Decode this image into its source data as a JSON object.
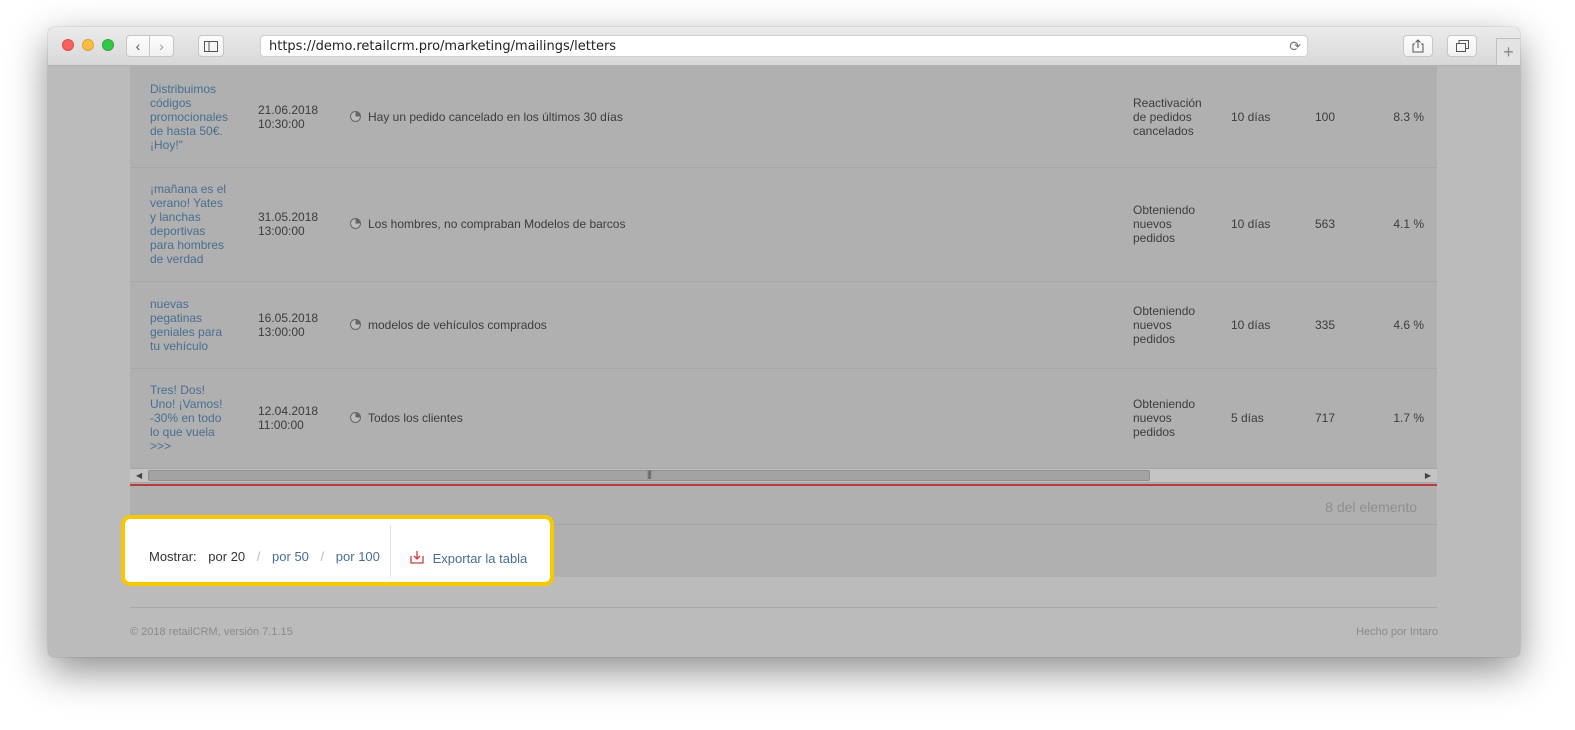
{
  "browser": {
    "url": "https://demo.retailcrm.pro/marketing/mailings/letters",
    "icons": {
      "back": "chevron-left-icon",
      "forward": "chevron-right-icon",
      "sidebar": "sidebar-icon",
      "reload": "reload-icon",
      "share": "share-icon",
      "tabs": "tabs-icon",
      "new_tab": "plus-icon"
    }
  },
  "table": {
    "rows": [
      {
        "title_lines": [
          "Distribuimos",
          "códigos",
          "promocionales",
          "de hasta 50€.",
          "¡Hoy!\""
        ],
        "date_lines": [
          "21.06.2018",
          "10:30:00"
        ],
        "segment": "Hay un pedido cancelado en los últimos 30 días",
        "goal_lines": [
          "Reactivación",
          "de pedidos",
          "cancelados"
        ],
        "days": "10 días",
        "count": "100",
        "percent": "8.3 %"
      },
      {
        "title_lines": [
          "¡mañana es el",
          "verano! Yates",
          "y lanchas",
          "deportivas",
          "para hombres",
          "de verdad"
        ],
        "date_lines": [
          "31.05.2018",
          "13:00:00"
        ],
        "segment": "Los hombres, no compraban Modelos de barcos",
        "goal_lines": [
          "Obteniendo",
          "nuevos",
          "pedidos"
        ],
        "days": "10 días",
        "count": "563",
        "percent": "4.1 %"
      },
      {
        "title_lines": [
          "nuevas",
          "pegatinas",
          "geniales para",
          "tu vehículo"
        ],
        "date_lines": [
          "16.05.2018",
          "13:00:00"
        ],
        "segment": "modelos de vehículos comprados",
        "goal_lines": [
          "Obteniendo",
          "nuevos",
          "pedidos"
        ],
        "days": "10 días",
        "count": "335",
        "percent": "4.6 %"
      },
      {
        "title_lines": [
          "Tres! Dos!",
          "Uno! ¡Vamos!",
          "-30% en todo",
          "lo que vuela",
          ">>>"
        ],
        "date_lines": [
          "12.04.2018",
          "11:00:00"
        ],
        "segment": "Todos los clientes",
        "goal_lines": [
          "Obteniendo",
          "nuevos",
          "pedidos"
        ],
        "days": "5 días",
        "count": "717",
        "percent": "1.7 %"
      }
    ],
    "segment_icon": "pie-chart-icon",
    "total_label": "8 del elemento"
  },
  "pager": {
    "label": "Mostrar:",
    "current": "por 20",
    "options": [
      "por 50",
      "por 100"
    ],
    "separator": "/",
    "export_label": "Exportar la tabla",
    "export_icon": "download-icon",
    "highlight_color": "#f5c800"
  },
  "footer": {
    "copyright": "© 2018 retailCRM, versión 7.1.15",
    "made_by": "Hecho por Intaro"
  }
}
